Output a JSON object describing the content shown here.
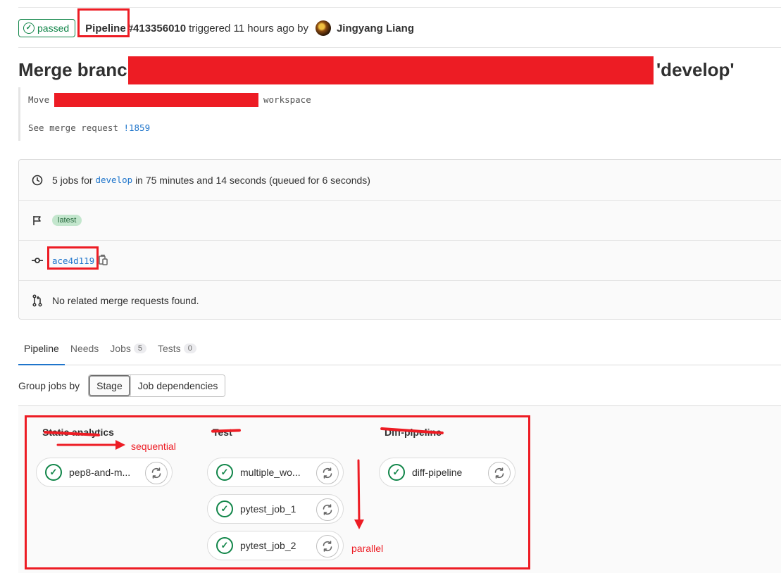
{
  "header": {
    "status": "passed",
    "pipeline_label": "Pipeline",
    "pipeline_id": "#413356010",
    "triggered_text": "triggered 11 hours ago by",
    "author": "Jingyang Liang"
  },
  "commit": {
    "title_start": "Merge branch",
    "title_end": "'develop'",
    "desc_line1_start": "Move a",
    "desc_line1_end": "workspace",
    "desc_line2_start": "See merge request",
    "mr_link": "!1859"
  },
  "info": {
    "jobs_prefix": "5 jobs for",
    "branch": "develop",
    "jobs_suffix": "in 75 minutes and 14 seconds (queued for 6 seconds)",
    "badge": "latest",
    "commit_sha": "ace4d119",
    "mr_text": "No related merge requests found."
  },
  "tabs": [
    {
      "label": "Pipeline",
      "count": null
    },
    {
      "label": "Needs",
      "count": null
    },
    {
      "label": "Jobs",
      "count": "5"
    },
    {
      "label": "Tests",
      "count": "0"
    }
  ],
  "group_by": {
    "label": "Group jobs by",
    "options": [
      "Stage",
      "Job dependencies"
    ],
    "selected": "Stage"
  },
  "stages": [
    {
      "title": "Static analytics",
      "jobs": [
        "pep8-and-m..."
      ]
    },
    {
      "title": "Test",
      "jobs": [
        "multiple_wo...",
        "pytest_job_1",
        "pytest_job_2"
      ]
    },
    {
      "title": "Diff-pipeline",
      "jobs": [
        "diff-pipeline"
      ]
    }
  ],
  "annotations": {
    "sequential": "sequential",
    "parallel": "parallel"
  },
  "colors": {
    "success": "#108548",
    "link": "#1f75cb",
    "annotation_red": "#ed1c24"
  }
}
